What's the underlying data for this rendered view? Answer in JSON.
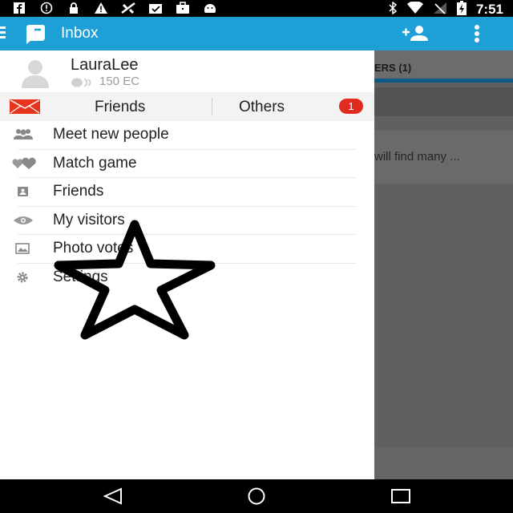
{
  "status_bar": {
    "left_icons": [
      "facebook-icon",
      "info-icon",
      "lock-icon",
      "warning-icon",
      "no-signal-app-icon",
      "clipboard-check-icon",
      "briefcase-icon",
      "android-icon"
    ],
    "right_icons": [
      "bluetooth-icon",
      "wifi-icon",
      "signal-icon",
      "battery-charging-icon"
    ],
    "time": "7:51"
  },
  "app_bar": {
    "title": "Inbox",
    "color": "#1e9fd6"
  },
  "drawer": {
    "profile": {
      "name": "LauraLee",
      "coins": "150 EC"
    },
    "tabs": {
      "friends": "Friends",
      "others": "Others",
      "others_badge": "1"
    },
    "menu": [
      {
        "label": "Meet new people",
        "icon": "people-icon"
      },
      {
        "label": "Match game",
        "icon": "hearts-icon"
      },
      {
        "label": "Friends",
        "icon": "contact-card-icon"
      },
      {
        "label": "My visitors",
        "icon": "eye-icon"
      },
      {
        "label": "Photo votes",
        "icon": "photo-icon"
      },
      {
        "label": "Settings",
        "icon": "gear-icon"
      }
    ]
  },
  "background": {
    "tab_text": "ERS (1)",
    "row_text": "will find many ..."
  },
  "overlay": {
    "shape": "star-outline"
  },
  "nav_bar": {
    "buttons": [
      "back-icon",
      "home-icon",
      "recents-icon"
    ]
  }
}
